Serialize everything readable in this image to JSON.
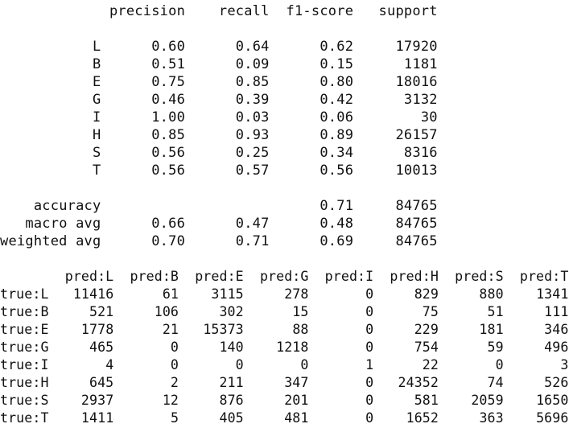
{
  "classification_report": {
    "header": [
      "precision",
      "recall",
      "f1-score",
      "support"
    ],
    "rows": [
      {
        "label": "L",
        "precision": "0.60",
        "recall": "0.64",
        "f1": "0.62",
        "support": "17920"
      },
      {
        "label": "B",
        "precision": "0.51",
        "recall": "0.09",
        "f1": "0.15",
        "support": "1181"
      },
      {
        "label": "E",
        "precision": "0.75",
        "recall": "0.85",
        "f1": "0.80",
        "support": "18016"
      },
      {
        "label": "G",
        "precision": "0.46",
        "recall": "0.39",
        "f1": "0.42",
        "support": "3132"
      },
      {
        "label": "I",
        "precision": "1.00",
        "recall": "0.03",
        "f1": "0.06",
        "support": "30"
      },
      {
        "label": "H",
        "precision": "0.85",
        "recall": "0.93",
        "f1": "0.89",
        "support": "26157"
      },
      {
        "label": "S",
        "precision": "0.56",
        "recall": "0.25",
        "f1": "0.34",
        "support": "8316"
      },
      {
        "label": "T",
        "precision": "0.56",
        "recall": "0.57",
        "f1": "0.56",
        "support": "10013"
      }
    ],
    "summary": [
      {
        "label": "accuracy",
        "precision": "",
        "recall": "",
        "f1": "0.71",
        "support": "84765"
      },
      {
        "label": "macro avg",
        "precision": "0.66",
        "recall": "0.47",
        "f1": "0.48",
        "support": "84765"
      },
      {
        "label": "weighted avg",
        "precision": "0.70",
        "recall": "0.71",
        "f1": "0.69",
        "support": "84765"
      }
    ]
  },
  "confusion_matrix": {
    "columns": [
      "pred:L",
      "pred:B",
      "pred:E",
      "pred:G",
      "pred:I",
      "pred:H",
      "pred:S",
      "pred:T"
    ],
    "rows": [
      {
        "label": "true:L",
        "values": [
          "11416",
          "61",
          "3115",
          "278",
          "0",
          "829",
          "880",
          "1341"
        ]
      },
      {
        "label": "true:B",
        "values": [
          "521",
          "106",
          "302",
          "15",
          "0",
          "75",
          "51",
          "111"
        ]
      },
      {
        "label": "true:E",
        "values": [
          "1778",
          "21",
          "15373",
          "88",
          "0",
          "229",
          "181",
          "346"
        ]
      },
      {
        "label": "true:G",
        "values": [
          "465",
          "0",
          "140",
          "1218",
          "0",
          "754",
          "59",
          "496"
        ]
      },
      {
        "label": "true:I",
        "values": [
          "4",
          "0",
          "0",
          "0",
          "1",
          "22",
          "0",
          "3"
        ]
      },
      {
        "label": "true:H",
        "values": [
          "645",
          "2",
          "211",
          "347",
          "0",
          "24352",
          "74",
          "526"
        ]
      },
      {
        "label": "true:S",
        "values": [
          "2937",
          "12",
          "876",
          "201",
          "0",
          "581",
          "2059",
          "1650"
        ]
      },
      {
        "label": "true:T",
        "values": [
          "1411",
          "5",
          "405",
          "481",
          "0",
          "1652",
          "363",
          "5696"
        ]
      }
    ]
  }
}
